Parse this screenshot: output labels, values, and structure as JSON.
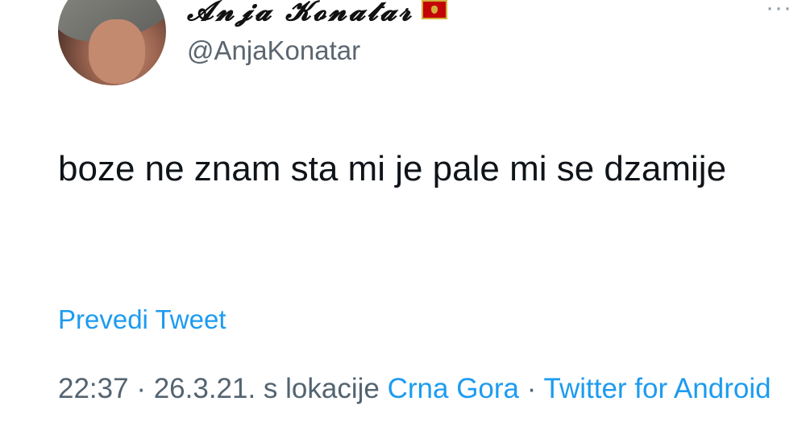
{
  "author": {
    "display_name": "𝓐𝓷𝓳𝓪 𝓚𝓸𝓷𝓪𝓽𝓪𝓻",
    "handle": "@AnjaKonatar",
    "flag_icon": "montenegro-flag-icon"
  },
  "tweet": {
    "text": "boze ne znam sta mi je pale mi se dzamije"
  },
  "translate_label": "Prevedi Tweet",
  "meta": {
    "time": "22:37",
    "separator": " · ",
    "date": "26.3.21.",
    "location_prefix": " s lokacije ",
    "location": "Crna Gora",
    "separator2": " · ",
    "source": "Twitter for Android"
  },
  "more_icon": "more-horizontal-icon",
  "colors": {
    "link": "#1d9bf0",
    "secondary": "#536471",
    "text": "#0f1419"
  }
}
